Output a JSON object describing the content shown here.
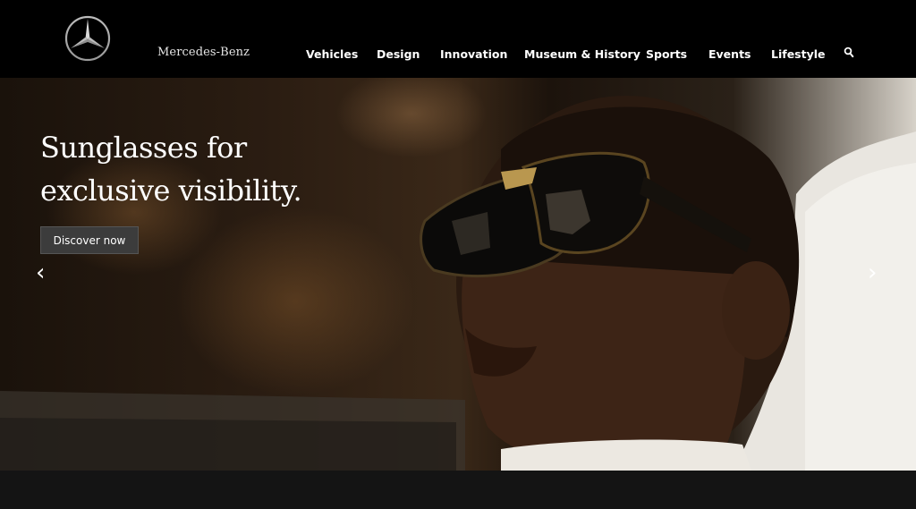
{
  "header": {
    "brand": "Mercedes-Benz",
    "logo_icon": "mercedes-star-logo",
    "nav": [
      {
        "label": "Vehicles"
      },
      {
        "label": "Design"
      },
      {
        "label": "Innovation"
      },
      {
        "label": "Museum & History"
      },
      {
        "label": "Sports"
      },
      {
        "label": "Events"
      },
      {
        "label": "Lifestyle"
      }
    ],
    "search_icon": "search-icon"
  },
  "hero": {
    "title": "Sunglasses for exclusive visibility.",
    "cta_label": "Discover now",
    "prev_arrow": "‹",
    "next_arrow": "›"
  },
  "colors": {
    "header_bg": "#000000",
    "cta_bg": "#3c3c3c",
    "footer_band": "#141414"
  }
}
